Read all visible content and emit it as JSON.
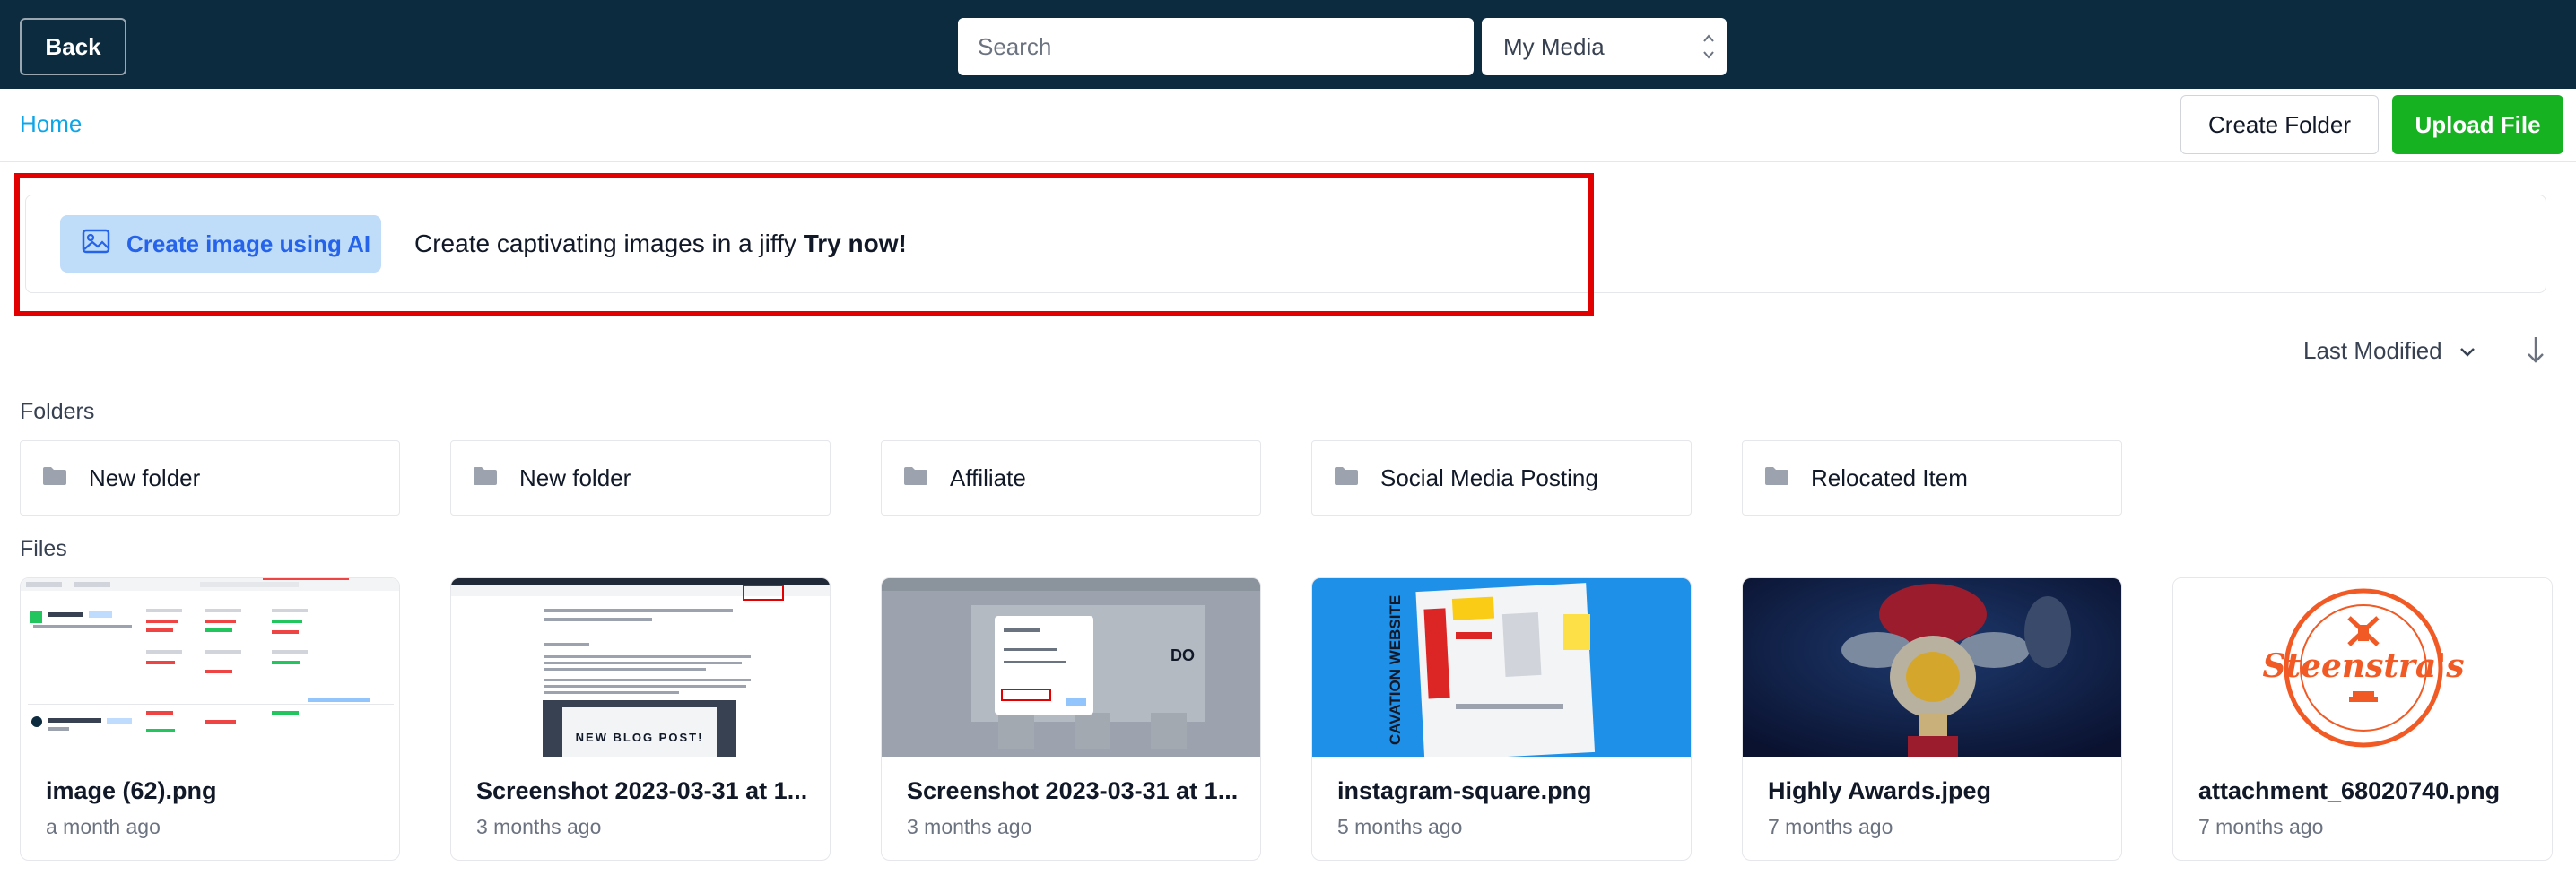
{
  "topbar": {
    "back_label": "Back",
    "search_placeholder": "Search",
    "media_select_value": "My Media"
  },
  "subheader": {
    "breadcrumb_home": "Home",
    "create_folder_label": "Create Folder",
    "upload_file_label": "Upload File"
  },
  "ai_banner": {
    "button_label": "Create image using AI",
    "text": "Create captivating images in a jiffy",
    "cta": "Try now!"
  },
  "sort": {
    "label": "Last Modified"
  },
  "sections": {
    "folders_label": "Folders",
    "files_label": "Files"
  },
  "folders": [
    {
      "name": "New folder"
    },
    {
      "name": "New folder"
    },
    {
      "name": "Affiliate"
    },
    {
      "name": "Social Media Posting"
    },
    {
      "name": "Relocated Item"
    }
  ],
  "files": [
    {
      "name": "image (62).png",
      "date": "a month ago"
    },
    {
      "name": "Screenshot 2023-03-31 at 1...",
      "date": "3 months ago"
    },
    {
      "name": "Screenshot 2023-03-31 at 1...",
      "date": "3 months ago"
    },
    {
      "name": "instagram-square.png",
      "date": "5 months ago"
    },
    {
      "name": "Highly Awards.jpeg",
      "date": "7 months ago"
    },
    {
      "name": "attachment_68020740.png",
      "date": "7 months ago"
    }
  ],
  "thumb_texts": {
    "blog": "NEW BLOG POST!",
    "steenstras": "Steenstra's",
    "excavation": "CAVATION WEBSITE"
  },
  "colors": {
    "topbar": "#0c2b3f",
    "accent_link": "#0ea5e9",
    "upload_green": "#16b221",
    "ai_button_bg": "#bfdcf9",
    "highlight_red": "#e30000"
  }
}
